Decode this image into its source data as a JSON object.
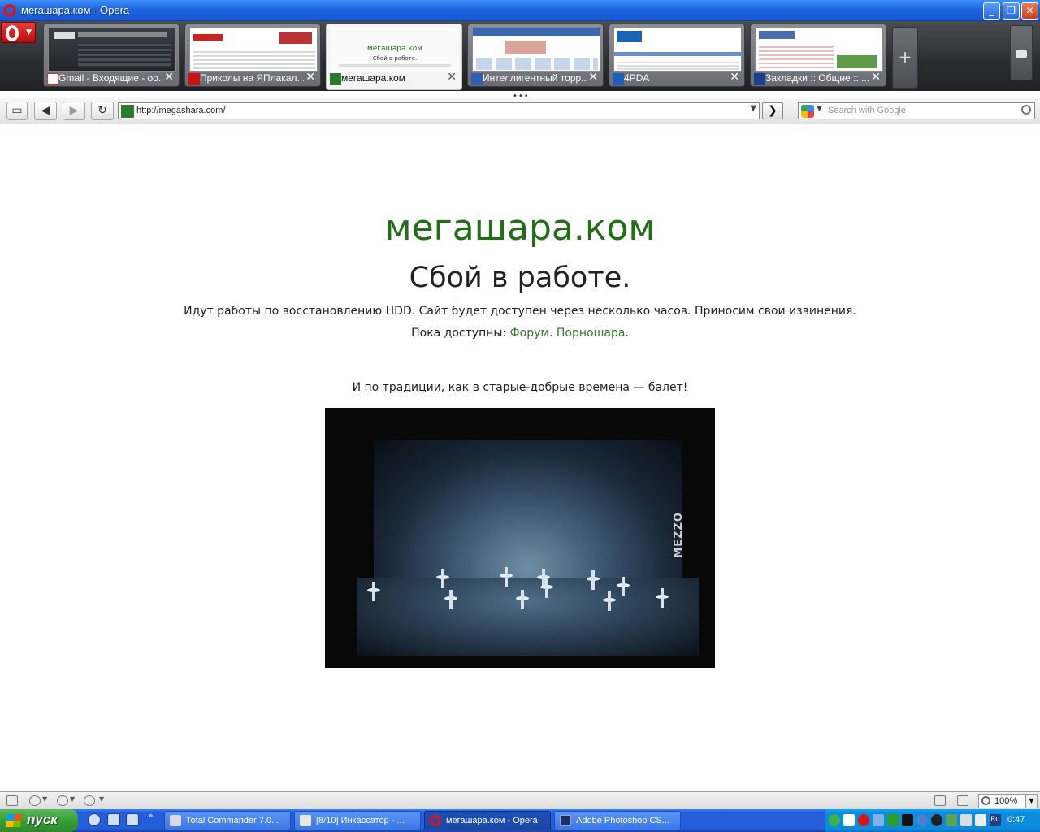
{
  "window": {
    "title": "мегашара.ком - Opera",
    "controls": [
      "minimize",
      "restore",
      "close"
    ]
  },
  "tabs": [
    {
      "label": "Gmail - Входящие - oo...",
      "favicon": "gmail-icon",
      "active": false
    },
    {
      "label": "Приколы на ЯПлакал...",
      "favicon": "yaplakal-icon",
      "active": false
    },
    {
      "label": "мегашара.ком",
      "favicon": "megashara-icon",
      "active": true,
      "thumb_title": "мегашара.ком",
      "thumb_sub": "Сбой в работе."
    },
    {
      "label": "Интеллигентный торр...",
      "favicon": "torrent-icon",
      "active": false
    },
    {
      "label": "4PDA",
      "favicon": "4pda-icon",
      "active": false
    },
    {
      "label": "Закладки :: Общие :: ...",
      "favicon": "ru-icon",
      "active": false
    }
  ],
  "toolbar": {
    "url": "http://megashara.com/",
    "search_placeholder": "Search with Google"
  },
  "page": {
    "site_name": "мегашара.ком",
    "error_title": "Сбой в работе.",
    "message": "Идут работы по восстановлению HDD. Сайт будет доступен через несколько часов. Приносим свои извинения.",
    "available_prefix": "Пока доступны: ",
    "link_forum": "Форум",
    "link_sep": ". ",
    "link_porn": "Порношара",
    "available_suffix": ".",
    "ballet_text": "И по традиции, как в старые-добрые времена — балет!",
    "video_logo": "MEZZO"
  },
  "statusbar": {
    "zoom": "100%"
  },
  "taskbar": {
    "start_label": "пуск",
    "tasks": [
      {
        "label": "Total Commander 7.0...",
        "active": false
      },
      {
        "label": "[8/10] Инкассатор - ...",
        "active": false
      },
      {
        "label": "мегашара.ком - Opera",
        "active": true
      },
      {
        "label": "Adobe Photoshop CS...",
        "active": false
      }
    ],
    "clock": "0:47"
  },
  "colors": {
    "site_green": "#1f6f14",
    "link_green": "#2a7d1f",
    "xp_blue": "#245edb",
    "opera_red": "#d8151c"
  }
}
